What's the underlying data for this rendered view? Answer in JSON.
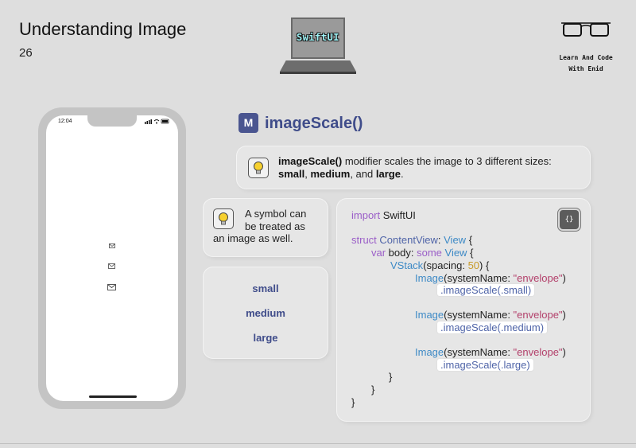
{
  "header": {
    "title": "Understanding Image",
    "number": "26"
  },
  "logo": {
    "laptop_text": "SwiftUI",
    "brand_line1": "Learn And Code",
    "brand_line2": "With Enid"
  },
  "phone": {
    "time": "12:04",
    "status_icons": "▪▪ ⌔ ▭"
  },
  "heading": {
    "badge": "M",
    "title": "imageScale()"
  },
  "tip": {
    "part1": "imageScale()",
    "part2": " modifier scales the image to 3 different sizes: ",
    "small": "small",
    "sep1": ", ",
    "medium": "medium",
    "sep2": ", and ",
    "large": "large",
    "end": "."
  },
  "symbol_note": {
    "line1": "A symbol can",
    "line2": "be treated as",
    "line3": "an image as well."
  },
  "sizes": [
    "small",
    "medium",
    "large"
  ],
  "code": {
    "icon": "{}",
    "import_kw": "import",
    "import_mod": " SwiftUI",
    "struct_kw": "struct",
    "struct_name": " ContentView",
    "colon": ": ",
    "view": "View",
    "brace": " {",
    "var_kw": "var",
    "body": " body: ",
    "some_kw": "some",
    "some_view": " View",
    "vstack": "VStack",
    "spacing": "(spacing: ",
    "fifty": "50",
    "vclose": ") {",
    "image": "Image",
    "sysname": "(systemName: ",
    "envelope": "\"envelope\"",
    "paren": ")",
    "mod_small": ".imageScale(.small)",
    "mod_medium": ".imageScale(.medium)",
    "mod_large": ".imageScale(.large)",
    "close1": "}",
    "close2": "}",
    "close3": "}"
  },
  "colors": {
    "accent": "#3f4c8a",
    "keyword": "#9b5fc8",
    "type": "#3e8ac6",
    "string": "#b3406b",
    "number": "#c89b2a"
  }
}
